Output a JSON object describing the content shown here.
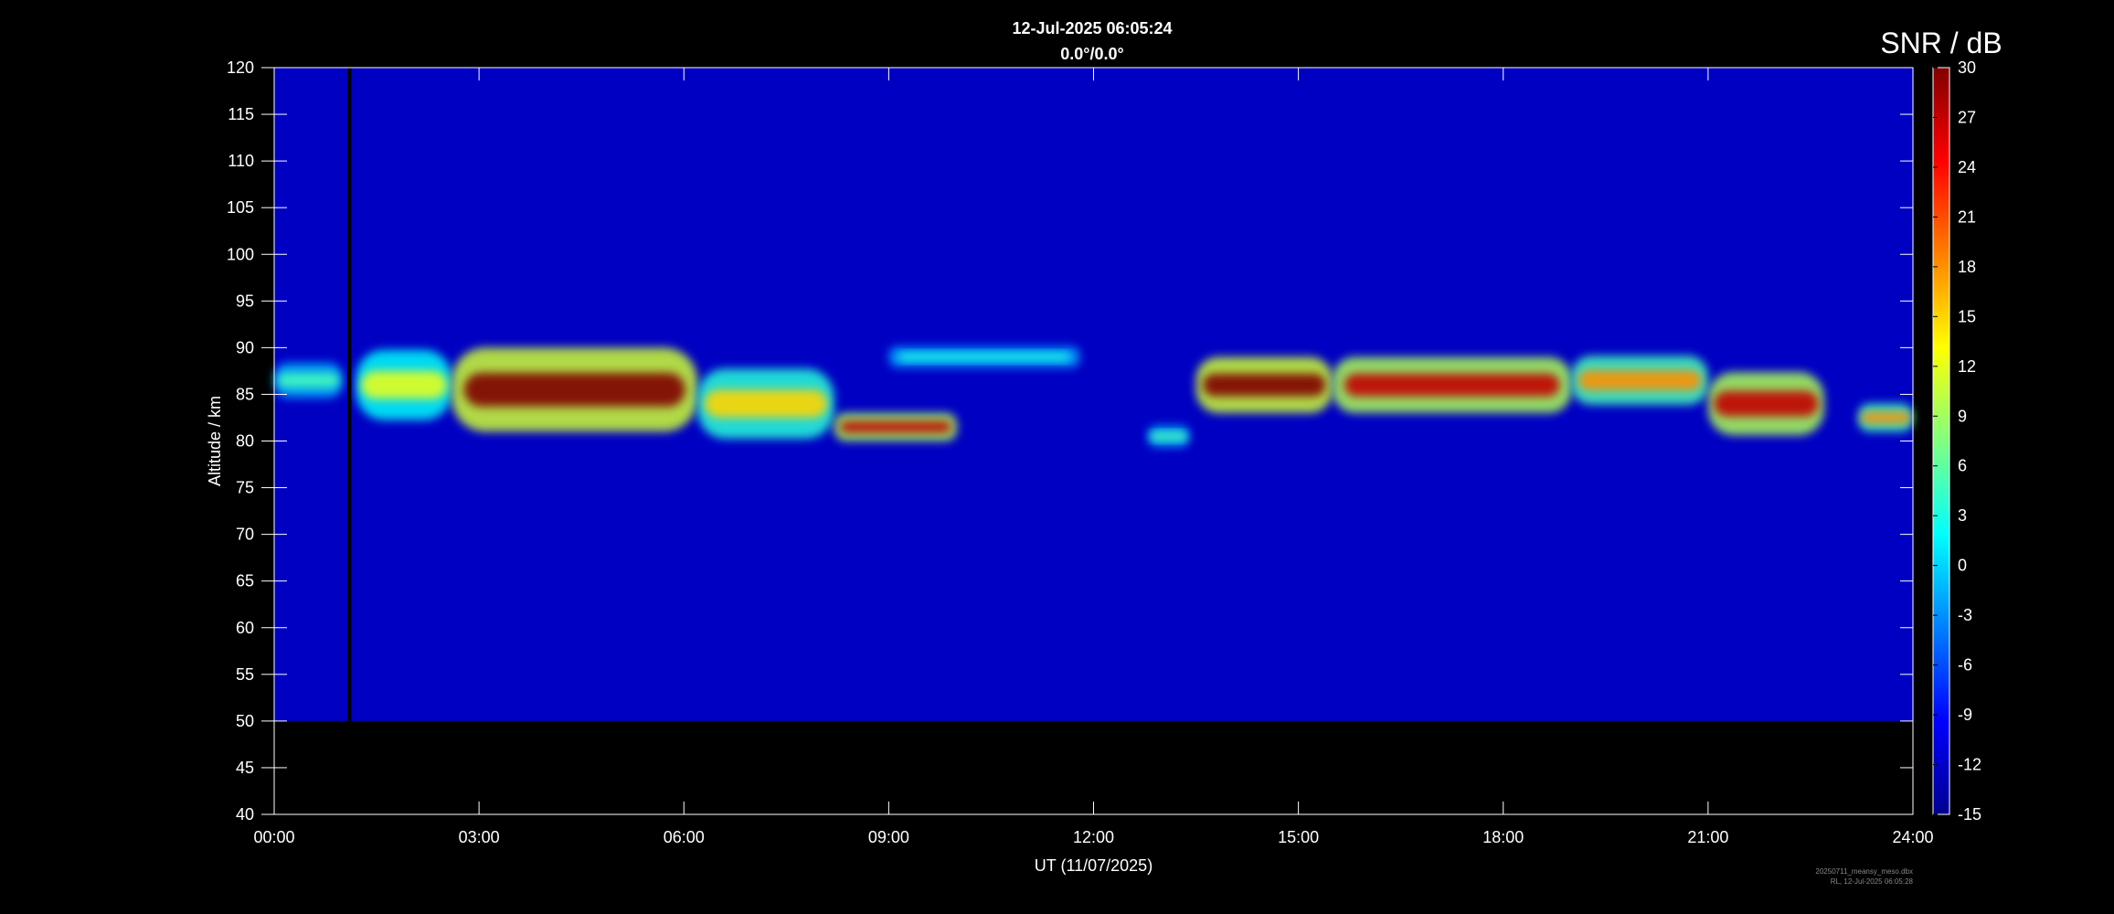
{
  "chart_data": {
    "type": "heatmap",
    "title": "12-Jul-2025 06:05:24",
    "subtitle": "0.0°/0.0°",
    "xlabel": "UT (11/07/2025)",
    "ylabel": "Altitude / km",
    "x_unit": "hours UT",
    "xlim": [
      0,
      24
    ],
    "ylim": [
      40,
      120
    ],
    "x_ticks": [
      "00:00",
      "03:00",
      "06:00",
      "09:00",
      "12:00",
      "15:00",
      "18:00",
      "21:00",
      "24:00"
    ],
    "y_ticks": [
      40,
      45,
      50,
      55,
      60,
      65,
      70,
      75,
      80,
      85,
      90,
      95,
      100,
      105,
      110,
      115,
      120
    ],
    "data_altitude_range": [
      50,
      120
    ],
    "data_gap_hours": [
      1.07,
      1.13
    ],
    "colorbar": {
      "title": "SNR / dB",
      "range": [
        -15,
        30
      ],
      "ticks": [
        -15,
        -12,
        -9,
        -6,
        -3,
        0,
        3,
        6,
        9,
        12,
        15,
        18,
        21,
        24,
        27,
        30
      ],
      "colormap": "jet"
    },
    "background_snr_db": -12,
    "echo_layers": [
      {
        "t_start": 0.0,
        "t_end": 1.0,
        "alt_center": 86.5,
        "alt_thickness": 2.5,
        "snr_peak": 5
      },
      {
        "t_start": 1.2,
        "t_end": 2.6,
        "alt_center": 86.0,
        "alt_thickness": 5.0,
        "snr_peak": 12
      },
      {
        "t_start": 2.6,
        "t_end": 6.2,
        "alt_center": 85.5,
        "alt_thickness": 6.0,
        "snr_peak": 30
      },
      {
        "t_start": 6.2,
        "t_end": 8.2,
        "alt_center": 84.0,
        "alt_thickness": 5.0,
        "snr_peak": 15
      },
      {
        "t_start": 8.2,
        "t_end": 10.0,
        "alt_center": 81.5,
        "alt_thickness": 2.0,
        "snr_peak": 27
      },
      {
        "t_start": 9.0,
        "t_end": 11.8,
        "alt_center": 89.0,
        "alt_thickness": 1.5,
        "snr_peak": 3
      },
      {
        "t_start": 12.8,
        "t_end": 13.4,
        "alt_center": 80.5,
        "alt_thickness": 1.5,
        "snr_peak": 5
      },
      {
        "t_start": 13.5,
        "t_end": 15.5,
        "alt_center": 86.0,
        "alt_thickness": 4.0,
        "snr_peak": 30
      },
      {
        "t_start": 15.5,
        "t_end": 19.0,
        "alt_center": 86.0,
        "alt_thickness": 4.0,
        "snr_peak": 27
      },
      {
        "t_start": 19.0,
        "t_end": 21.0,
        "alt_center": 86.5,
        "alt_thickness": 3.5,
        "snr_peak": 18
      },
      {
        "t_start": 21.0,
        "t_end": 22.7,
        "alt_center": 84.0,
        "alt_thickness": 4.5,
        "snr_peak": 27
      },
      {
        "t_start": 23.2,
        "t_end": 24.0,
        "alt_center": 82.5,
        "alt_thickness": 2.0,
        "snr_peak": 18
      }
    ],
    "footer_lines": [
      "20250711_meansy_meso.dbx",
      "RL, 12-Jul-2025 06:05:28"
    ]
  }
}
